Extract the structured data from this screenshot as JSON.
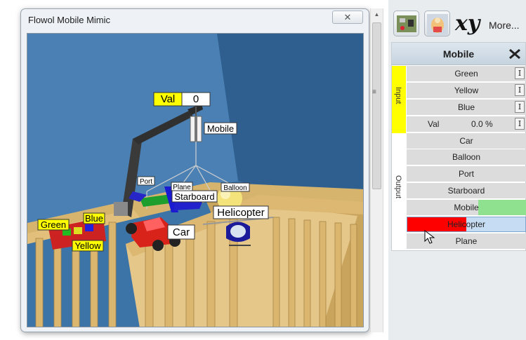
{
  "mimic": {
    "title": "Flowol Mobile Mimic",
    "close_label": "✕",
    "scene": {
      "val_label": "Val",
      "val_value": "0",
      "mobile_label": "Mobile",
      "port_label": "Port",
      "plane_label": "Plane",
      "balloon_label": "Balloon",
      "starboard_label": "Starboard",
      "helicopter_label": "Helicopter",
      "car_label": "Car",
      "green_label": "Green",
      "blue_label": "Blue",
      "yellow_label": "Yellow"
    }
  },
  "toolbar": {
    "xy_label": "xy",
    "more_label": "More..."
  },
  "panel": {
    "title": "Mobile",
    "input_group_label": "Input",
    "output_group_label": "Output",
    "inputs": [
      {
        "label": "Green",
        "button": "I"
      },
      {
        "label": "Yellow",
        "button": "I"
      },
      {
        "label": "Blue",
        "button": "I"
      },
      {
        "label": "Val",
        "value": "0.0 %",
        "button": "I"
      }
    ],
    "outputs": [
      {
        "label": "Car",
        "active": false
      },
      {
        "label": "Balloon",
        "active": false
      },
      {
        "label": "Port",
        "active": false
      },
      {
        "label": "Starboard",
        "active": false
      },
      {
        "label": "Mobile",
        "active": true,
        "color": "#8fe08f"
      },
      {
        "label": "Helicopter",
        "active": true,
        "color": "#ff0000"
      },
      {
        "label": "Plane",
        "active": false
      }
    ]
  },
  "colors": {
    "label_yellow": "#ffff00",
    "wall_blue": "#3d74a8",
    "crib_wood": "#d9b775",
    "active_green": "#8fe08f",
    "active_red": "#ff0000"
  }
}
